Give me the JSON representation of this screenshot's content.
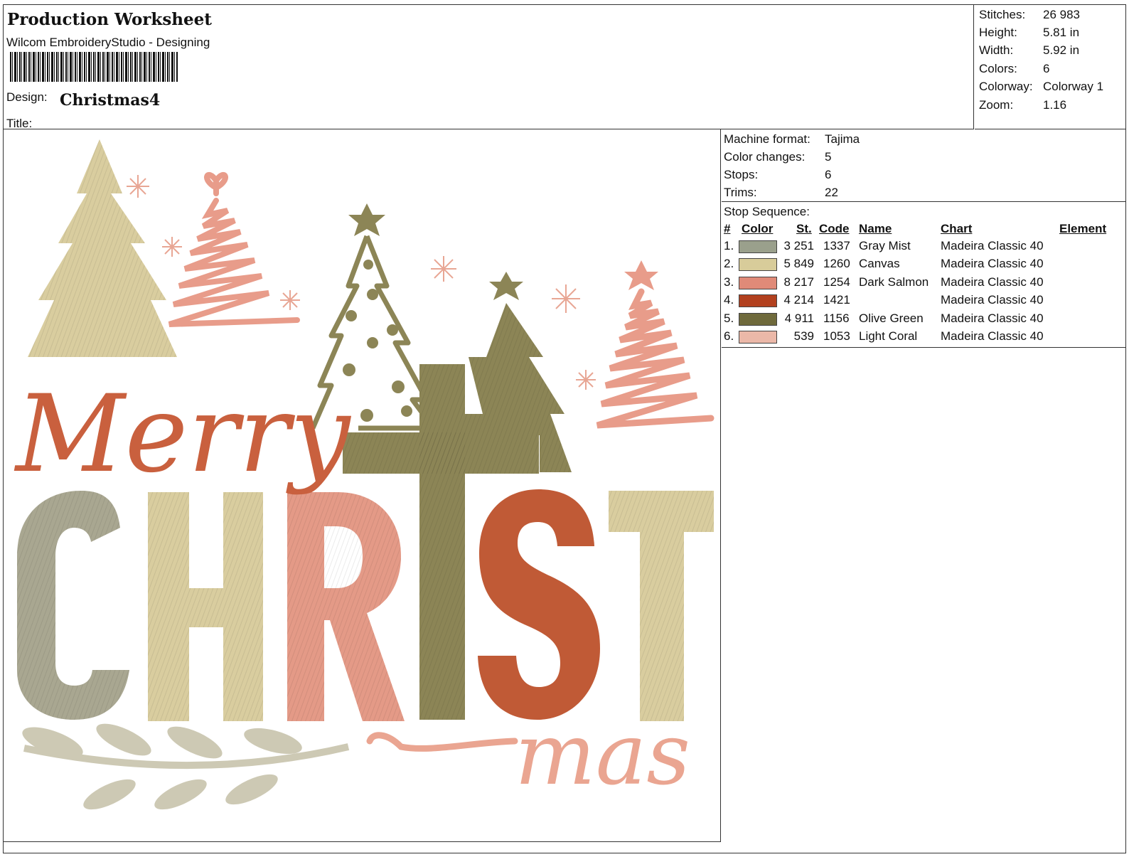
{
  "header": {
    "title": "Production Worksheet",
    "subtitle": "Wilcom EmbroideryStudio - Designing",
    "design_label": "Design:",
    "design_name": "Christmas4",
    "title_label": "Title:"
  },
  "stats": [
    {
      "key": "Stitches:",
      "value": "26 983"
    },
    {
      "key": "Height:",
      "value": "5.81 in"
    },
    {
      "key": "Width:",
      "value": "5.92 in"
    },
    {
      "key": "Colors:",
      "value": "6"
    },
    {
      "key": "Colorway:",
      "value": "Colorway 1"
    },
    {
      "key": "Zoom:",
      "value": "1.16"
    }
  ],
  "machine": [
    {
      "key": "Machine format:",
      "value": "Tajima"
    },
    {
      "key": "Color changes:",
      "value": "5"
    },
    {
      "key": "Stops:",
      "value": "6"
    },
    {
      "key": "Trims:",
      "value": "22"
    }
  ],
  "sequence": {
    "title": "Stop Sequence:",
    "headers": {
      "num": "#",
      "color": "Color",
      "st": "St.",
      "code": "Code",
      "name": "Name",
      "chart": "Chart",
      "element": "Element"
    },
    "rows": [
      {
        "num": "1.",
        "swatch": "#9aa08c",
        "st": "3 251",
        "code": "1337",
        "name": "Gray Mist",
        "chart": "Madeira Classic 40"
      },
      {
        "num": "2.",
        "swatch": "#d8cc9a",
        "st": "5 849",
        "code": "1260",
        "name": "Canvas",
        "chart": "Madeira Classic 40"
      },
      {
        "num": "3.",
        "swatch": "#e08a78",
        "st": "8 217",
        "code": "1254",
        "name": "Dark Salmon",
        "chart": "Madeira Classic 40"
      },
      {
        "num": "4.",
        "swatch": "#b2401e",
        "st": "4 214",
        "code": "1421",
        "name": "",
        "chart": "Madeira Classic 40"
      },
      {
        "num": "5.",
        "swatch": "#6f6a3c",
        "st": "4 911",
        "code": "1156",
        "name": "Olive Green",
        "chart": "Madeira Classic 40"
      },
      {
        "num": "6.",
        "swatch": "#ebb8a8",
        "st": "539",
        "code": "1053",
        "name": "Light Coral",
        "chart": "Madeira Classic 40"
      }
    ]
  },
  "design_art": {
    "word_merry": "Merry",
    "word_christ": [
      "C",
      "H",
      "R",
      "S",
      "T"
    ],
    "word_mas": "mas",
    "colors": {
      "gray": "#a9a791",
      "canvas": "#d9cd9f",
      "salmon": "#e49a87",
      "rust": "#c05a36",
      "olive": "#8c8556",
      "coral": "#eeb2a2"
    }
  }
}
